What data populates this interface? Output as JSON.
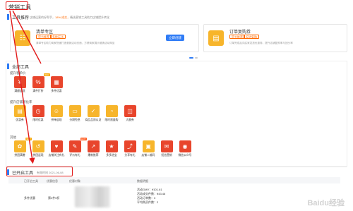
{
  "page": {
    "title": "营销工具"
  },
  "recommend": {
    "title": "工具推荐",
    "tip_pre": "店铺运营的好帮手，",
    "tip_highlight": "18% 成交，",
    "tip_post": "精选营销工具助力店铺提升转化"
  },
  "cards": [
    {
      "title": "清单专区",
      "tags": [
        "官方推荐",
        "多种玩法"
      ],
      "desc": "清单专区助力商家快速打造营销活动页面，方便商家展示营销活动商品",
      "button": "立即创建"
    },
    {
      "title": "订单复购券",
      "tags": [
        "官方推荐",
        "促进复购"
      ],
      "desc": "订单完成后向买家发放优惠券，提升店铺复购率与回头率",
      "button": ""
    }
  ],
  "all_tools": {
    "title": "全部工具",
    "groups": [
      {
        "label": "提升客单价",
        "tools": [
          {
            "name": "满额返现",
            "icon": "cash-icon",
            "badge": ""
          },
          {
            "name": "满件打折",
            "icon": "discount-icon",
            "badge": "NEW"
          },
          {
            "name": "多件优惠",
            "icon": "bundle-icon",
            "badge": ""
          }
        ]
      },
      {
        "label": "提升店铺转化率",
        "tools": [
          {
            "name": "优惠券",
            "icon": "coupon-icon",
            "badge": ""
          },
          {
            "name": "限时优惠",
            "icon": "clock-icon",
            "badge": ""
          },
          {
            "name": "拼单返现",
            "icon": "group-icon",
            "badge": ""
          },
          {
            "name": "分期免息",
            "icon": "card-icon",
            "badge": ""
          },
          {
            "name": "商品品质认证",
            "icon": "quality-icon",
            "badge": ""
          },
          {
            "name": "限时限量购",
            "icon": "limit-icon",
            "badge": ""
          },
          {
            "name": "大额券",
            "icon": "ticket-icon",
            "badge": ""
          }
        ]
      },
      {
        "label": "其他",
        "tools": [
          {
            "name": "拼团满赠",
            "icon": "gift-icon",
            "badge": "NEW"
          },
          {
            "name": "拼团返现",
            "icon": "return-icon",
            "badge": ""
          },
          {
            "name": "店铺关注有礼",
            "icon": "follow-icon",
            "badge": ""
          },
          {
            "name": "评价有礼",
            "icon": "review-icon",
            "badge": "HOT"
          },
          {
            "name": "爆款推荐",
            "icon": "trend-icon",
            "badge": ""
          },
          {
            "name": "多多进宝",
            "icon": "promote-icon",
            "badge": ""
          },
          {
            "name": "分享有礼",
            "icon": "share-icon",
            "badge": ""
          },
          {
            "name": "店铺二维码",
            "icon": "qrcode-icon",
            "badge": ""
          },
          {
            "name": "短信营销",
            "icon": "sms-icon",
            "badge": ""
          },
          {
            "name": "微信公众号",
            "icon": "wechat-icon",
            "badge": ""
          }
        ]
      }
    ]
  },
  "used": {
    "title": "已开启工具",
    "time_label": "有效时间 2021-06-08",
    "columns": [
      "已开启工具",
      "优惠信息",
      "优惠对象",
      "数据明细"
    ],
    "row": {
      "tool": "多件优惠",
      "offer": "第2件5折",
      "stats": [
        "活动GMV：¥101.61",
        "活动成交件数：¥43.46",
        "活动订单数：3",
        "平均购买件数：2"
      ]
    }
  },
  "watermark": "Baidu经验",
  "colors": {
    "accent": "#2f7cf6",
    "annotation": "#e21b1b",
    "tool_orange": "#f4a623",
    "tool_red": "#e8452c"
  }
}
